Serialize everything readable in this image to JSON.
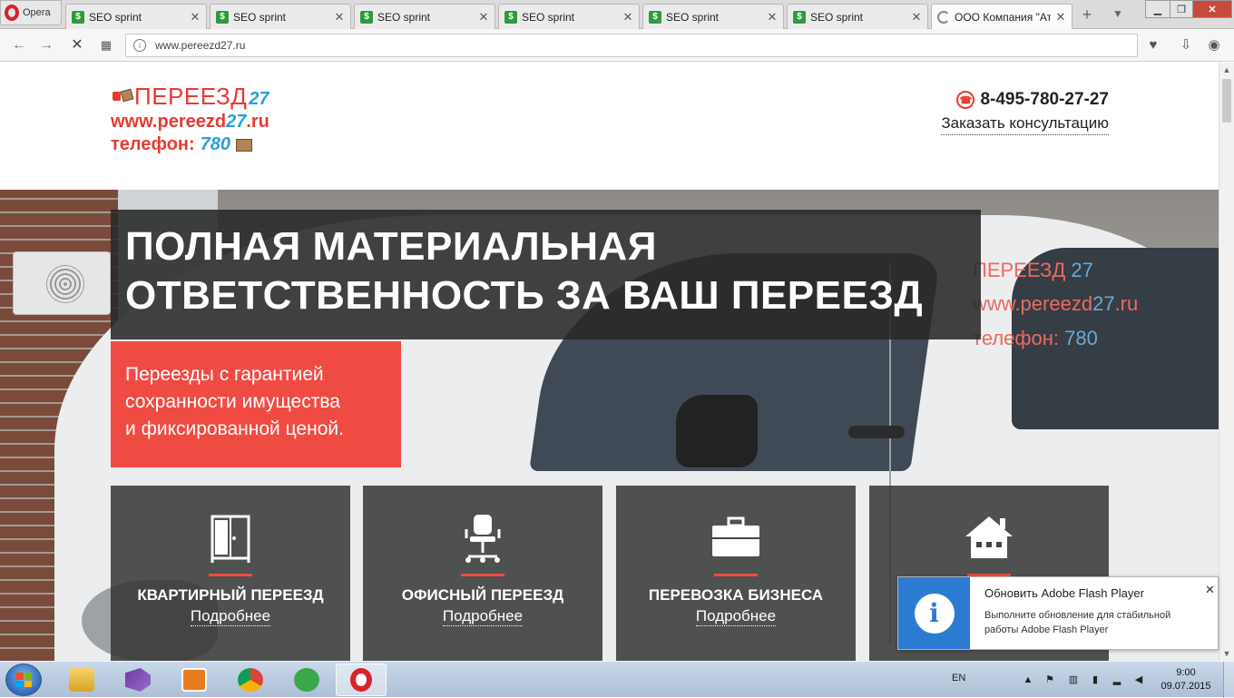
{
  "browser": {
    "opera_label": "Opera",
    "tabs": [
      {
        "title": "SEO sprint"
      },
      {
        "title": "SEO sprint"
      },
      {
        "title": "SEO sprint"
      },
      {
        "title": "SEO sprint"
      },
      {
        "title": "SEO sprint"
      },
      {
        "title": "SEO sprint"
      },
      {
        "title": "ООО Компания \"Ат"
      }
    ],
    "url": "www.pereezd27.ru"
  },
  "site": {
    "logo": {
      "name": "ПЕРЕЕЗД",
      "num": "27",
      "url_a": "www.pereezd",
      "url_num": "27",
      "url_b": ".ru",
      "phone_a": "телефон:",
      "phone_num": "780"
    },
    "contact": {
      "phone": "8-495-780-27-27",
      "consult": "Заказать консультацию"
    },
    "hero": {
      "title_line1": "ПОЛНАЯ МАТЕРИАЛЬНАЯ",
      "title_line2": "ОТВЕТСТВЕННОСТЬ ЗА ВАШ ПЕРЕЕЗД",
      "sub_line1": "Переезды с гарантией",
      "sub_line2": "сохранности имущества",
      "sub_line3": "и фиксированной ценой.",
      "van_logo_name": "ПЕРЕЕЗД",
      "van_logo_num": "27",
      "van_logo_url_a": "www.pereezd",
      "van_logo_url_num": "27",
      "van_logo_url_b": ".ru",
      "van_logo_phone_a": "телефон:",
      "van_logo_phone_num": "780"
    },
    "services": [
      {
        "title": "КВАРТИРНЫЙ ПЕРЕЕЗД",
        "more": "Подробнее",
        "icon": "wardrobe-icon"
      },
      {
        "title": "ОФИСНЫЙ ПЕРЕЕЗД",
        "more": "Подробнее",
        "icon": "office-chair-icon"
      },
      {
        "title": "ПЕРЕВОЗКА БИЗНЕСА",
        "more": "Подробнее",
        "icon": "briefcase-icon"
      },
      {
        "title": "",
        "more": "",
        "icon": "house-icon"
      }
    ],
    "accent_color": "#f04b42"
  },
  "flash": {
    "title": "Обновить Adobe Flash Player",
    "body": "Выполните обновление для стабильной работы Adobe Flash Player"
  },
  "taskbar": {
    "lang": "EN",
    "time": "9:00",
    "date": "09.07.2015"
  }
}
